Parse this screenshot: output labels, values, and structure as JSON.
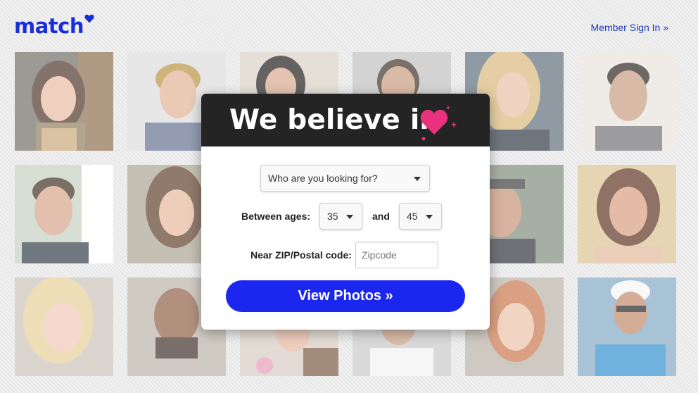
{
  "header": {
    "logo_text": "match",
    "signin_label": "Member Sign In »"
  },
  "colors": {
    "brand_blue": "#1a2ddb",
    "cta_blue": "#1b27ee",
    "heart_pink": "#e9317e",
    "modal_header_bg": "#242424"
  },
  "icons": {
    "logo_heart": "heart-icon",
    "headline_heart": "heart-sparkle-icon",
    "dropdown": "caret-down-icon"
  },
  "modal": {
    "headline": "We believe in",
    "seeking_select": {
      "value": "Who are you looking for?"
    },
    "ages_label": "Between ages:",
    "age_min": "35",
    "and_label": "and",
    "age_max": "45",
    "zip_label": "Near ZIP/Postal code:",
    "zip_placeholder": "Zipcode",
    "zip_value": "",
    "cta_label": "View Photos »"
  }
}
